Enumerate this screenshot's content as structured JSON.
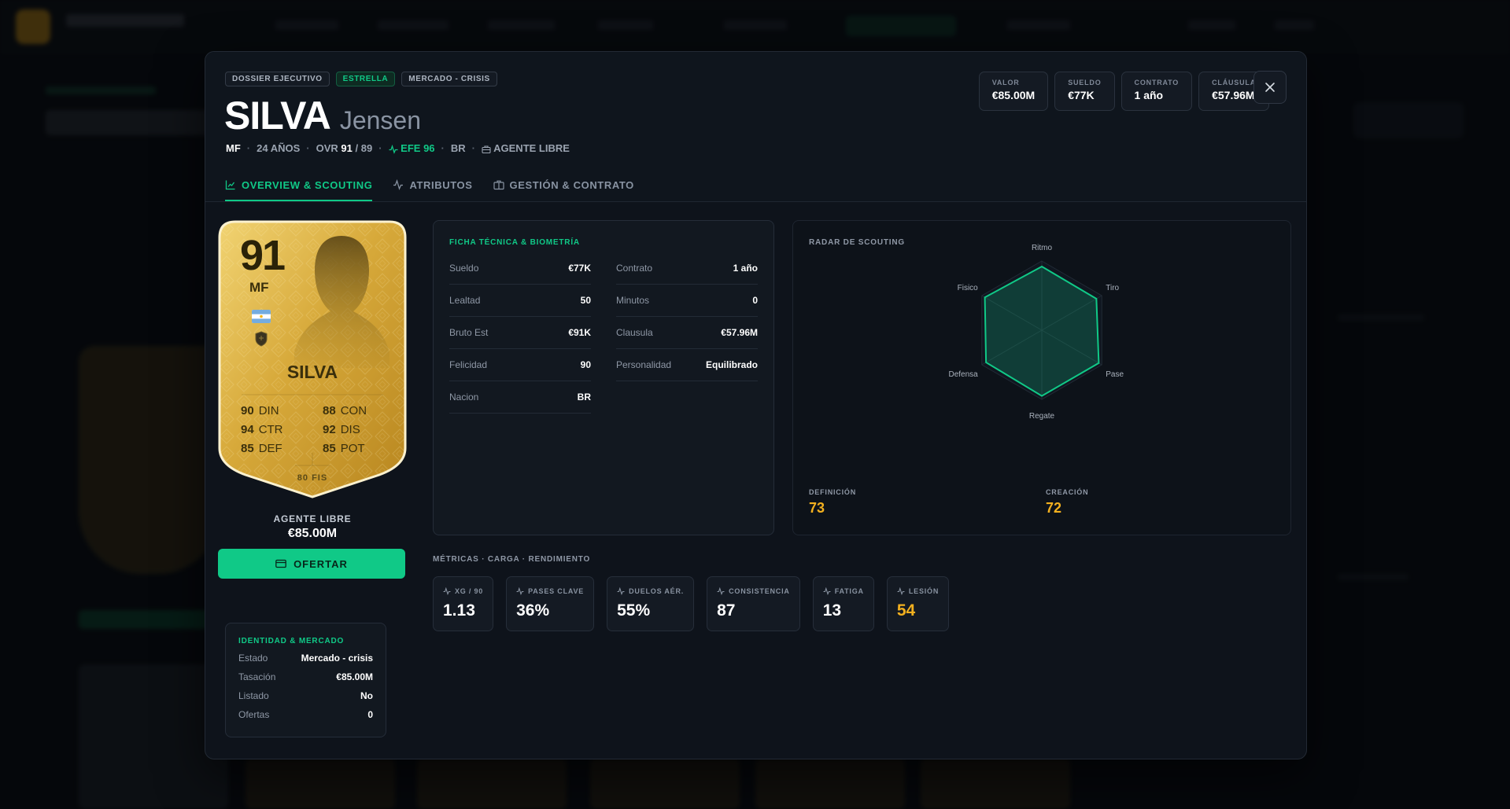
{
  "header": {
    "badges": [
      "DOSSIER EJECUTIVO",
      "ESTRELLA",
      "MERCADO - CRISIS"
    ],
    "surname": "SILVA",
    "firstname": "Jensen",
    "meta": {
      "position": "MF",
      "age": "24 AÑOS",
      "ovr_label": "OVR",
      "ovr_value": "91",
      "ovr_potential": "/ 89",
      "efe": "EFE 96",
      "nation": "BR",
      "status": "AGENTE LIBRE"
    },
    "tabs": [
      {
        "label": "OVERVIEW & SCOUTING",
        "icon": "chart-line-icon"
      },
      {
        "label": "ATRIBUTOS",
        "icon": "activity-icon"
      },
      {
        "label": "GESTIÓN & CONTRATO",
        "icon": "briefcase-icon"
      }
    ],
    "stats": [
      {
        "label": "VALOR",
        "value": "€85.00M"
      },
      {
        "label": "SUELDO",
        "value": "€77K"
      },
      {
        "label": "CONTRATO",
        "value": "1 año"
      },
      {
        "label": "CLÁUSULA",
        "value": "€57.96M"
      }
    ]
  },
  "card": {
    "ovr": "91",
    "position": "MF",
    "name": "SILVA",
    "stats": [
      {
        "value": "90",
        "label": "DIN"
      },
      {
        "value": "88",
        "label": "CON"
      },
      {
        "value": "94",
        "label": "CTR"
      },
      {
        "value": "92",
        "label": "DIS"
      },
      {
        "value": "85",
        "label": "DEF"
      },
      {
        "value": "85",
        "label": "POT"
      }
    ],
    "fis": "80 FIS",
    "agent_label": "AGENTE LIBRE",
    "agent_price": "€85.00M",
    "offer_label": "OFERTAR"
  },
  "identity": {
    "title": "IDENTIDAD & MERCADO",
    "rows": [
      {
        "k": "Estado",
        "v": "Mercado - crisis"
      },
      {
        "k": "Tasación",
        "v": "€85.00M"
      },
      {
        "k": "Listado",
        "v": "No"
      },
      {
        "k": "Ofertas",
        "v": "0"
      }
    ]
  },
  "ficha": {
    "title": "FICHA TÉCNICA & BIOMETRÍA",
    "left": [
      {
        "k": "Sueldo",
        "v": "€77K"
      },
      {
        "k": "Lealtad",
        "v": "50"
      },
      {
        "k": "Bruto Est",
        "v": "€91K"
      },
      {
        "k": "Felicidad",
        "v": "90"
      },
      {
        "k": "Nacion",
        "v": "BR"
      }
    ],
    "right": [
      {
        "k": "Contrato",
        "v": "1 año"
      },
      {
        "k": "Minutos",
        "v": "0"
      },
      {
        "k": "Clausula",
        "v": "€57.96M"
      },
      {
        "k": "Personalidad",
        "v": "Equilibrado"
      }
    ]
  },
  "radar": {
    "title": "RADAR DE SCOUTING",
    "axes": [
      {
        "label": "Ritmo",
        "value": 0.92
      },
      {
        "label": "Tiro",
        "value": 0.91
      },
      {
        "label": "Pase",
        "value": 0.95
      },
      {
        "label": "Regate",
        "value": 0.95
      },
      {
        "label": "Defensa",
        "value": 0.93
      },
      {
        "label": "Fisico",
        "value": 0.95
      }
    ],
    "kpis": [
      {
        "label": "DEFINICIÓN",
        "value": "73"
      },
      {
        "label": "CREACIÓN",
        "value": "72"
      }
    ],
    "colors": {
      "accent": "#10c987",
      "amber": "#f2b01f"
    }
  },
  "metrics": {
    "title": "MÉTRICAS · CARGA · RENDIMIENTO",
    "items": [
      {
        "label": "XG / 90",
        "value": "1.13"
      },
      {
        "label": "PASES CLAVE",
        "value": "36%"
      },
      {
        "label": "DUELOS AÉR.",
        "value": "55%"
      },
      {
        "label": "CONSISTENCIA",
        "value": "87"
      },
      {
        "label": "FATIGA",
        "value": "13"
      },
      {
        "label": "LESIÓN",
        "value": "54"
      }
    ]
  }
}
